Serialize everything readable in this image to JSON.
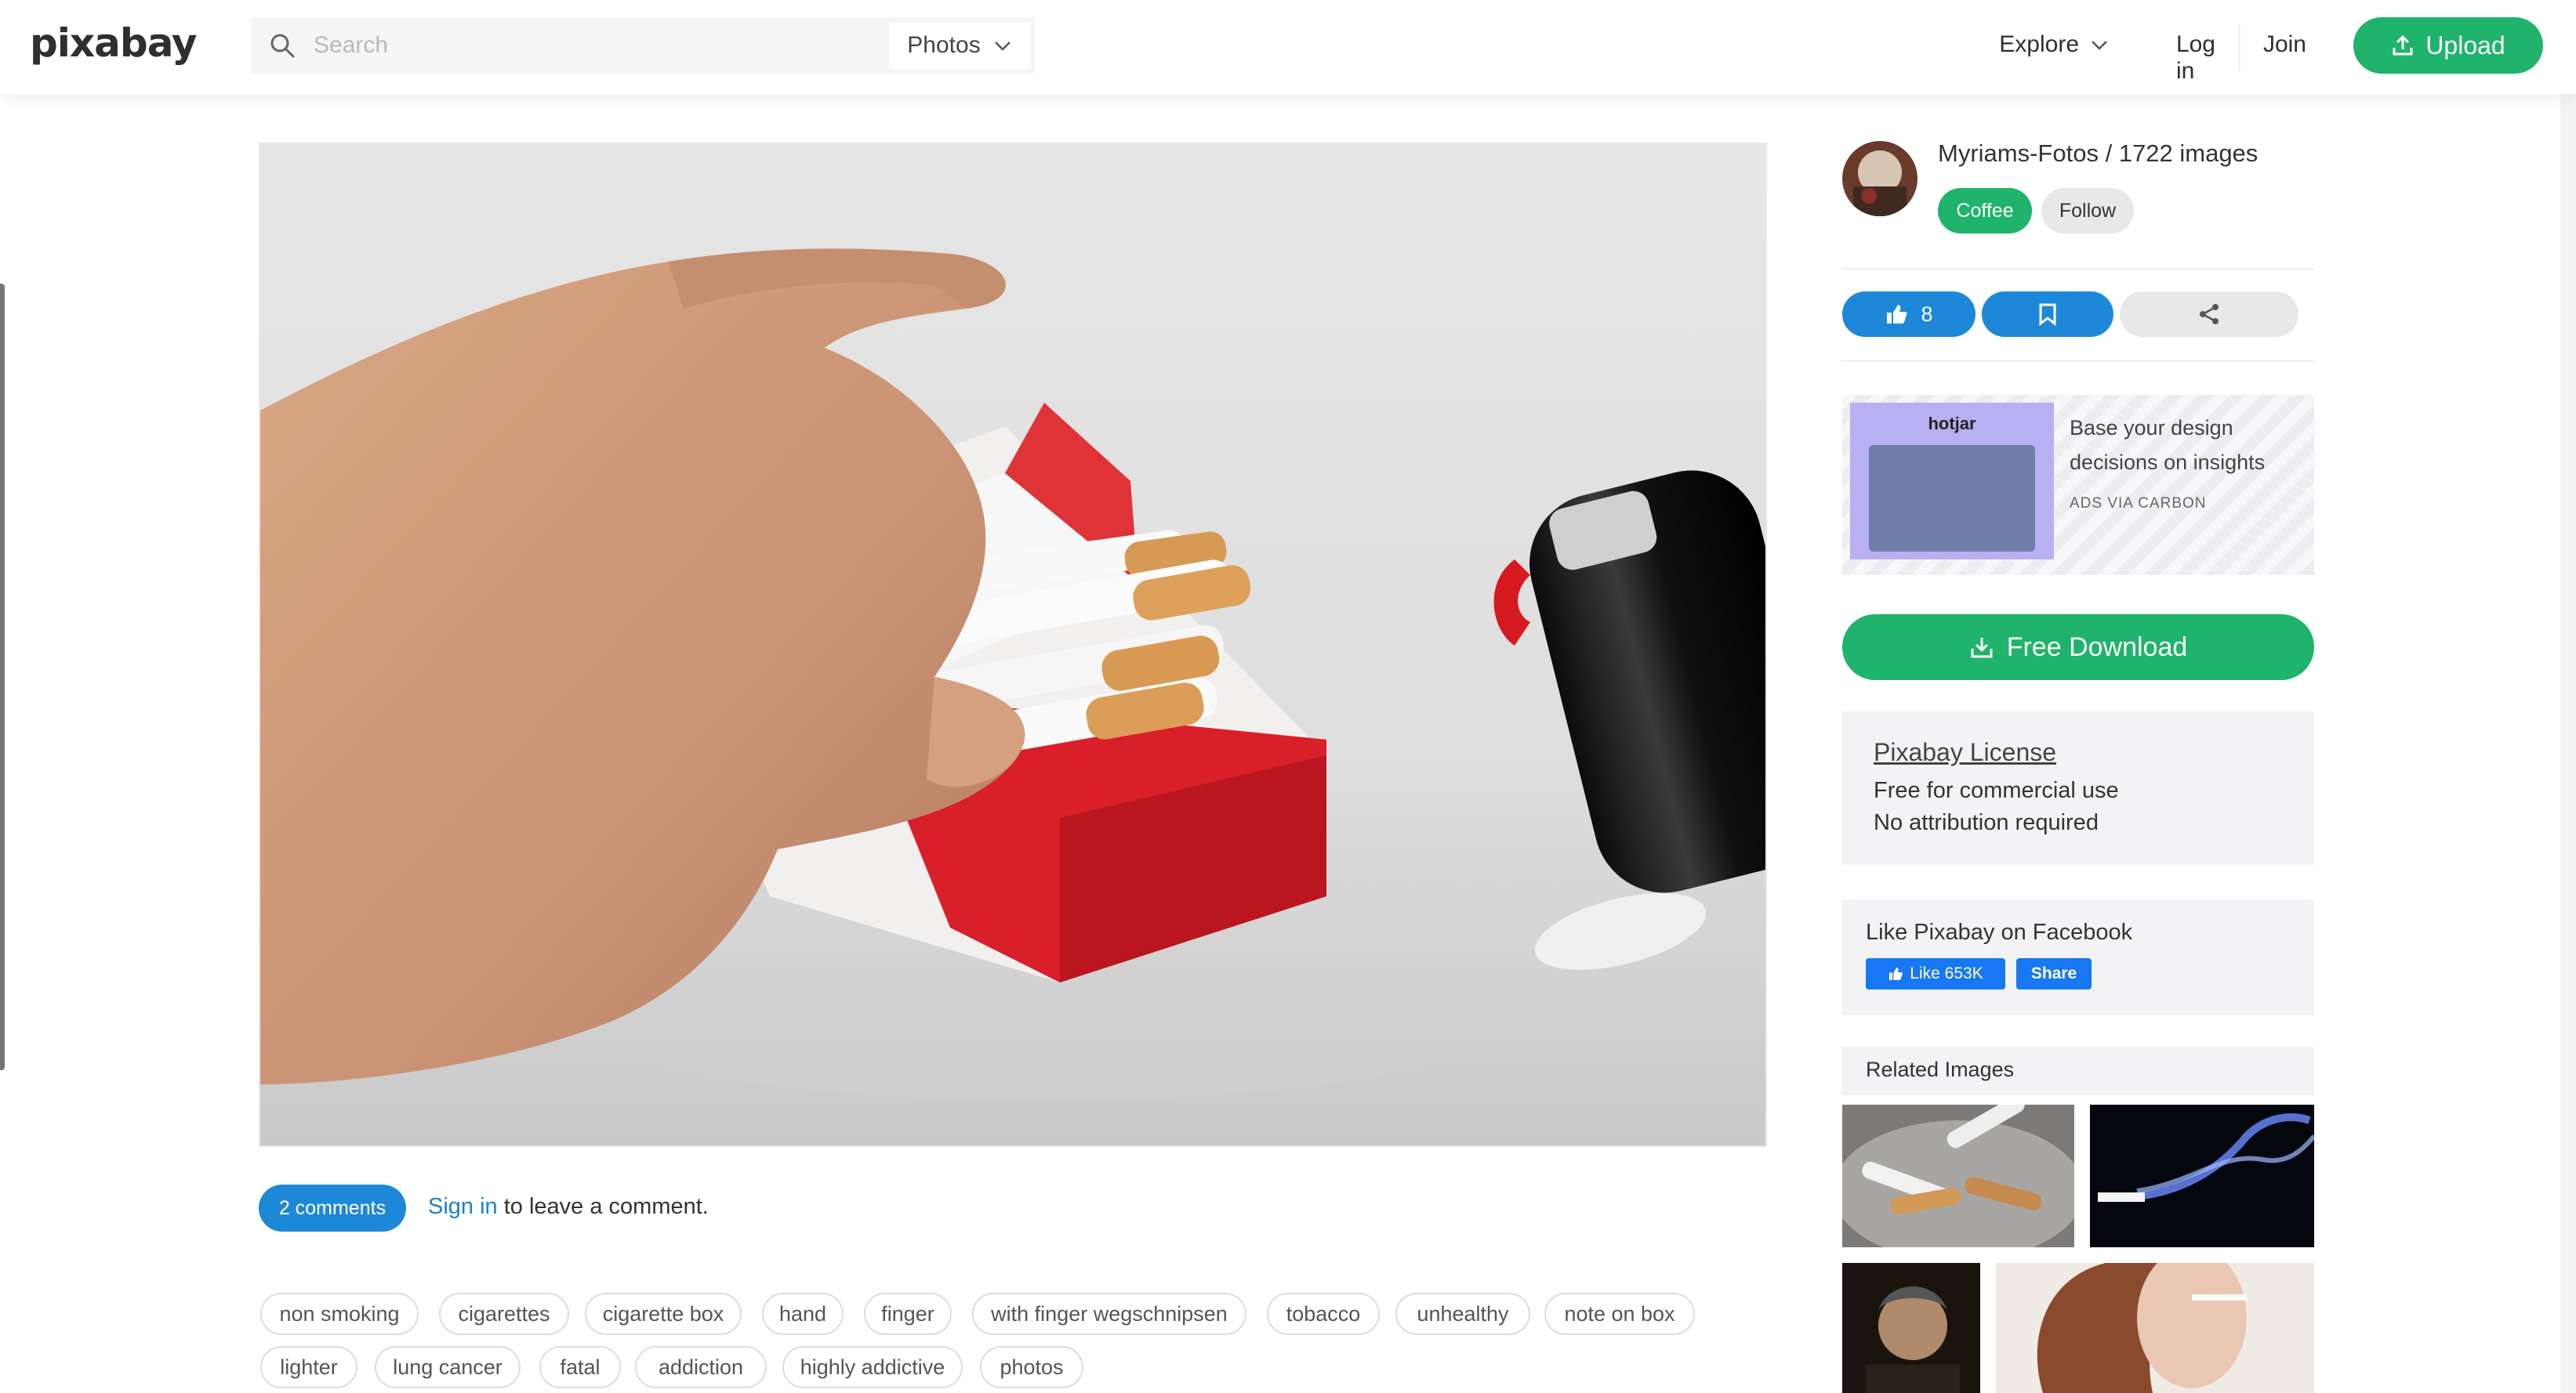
{
  "header": {
    "logo": "pixabay",
    "search_placeholder": "Search",
    "search_type": "Photos",
    "nav": {
      "explore": "Explore",
      "login": "Log in",
      "join": "Join",
      "upload": "Upload"
    }
  },
  "sidebar": {
    "author": "Myriams-Fotos / 1722 images",
    "coffee_label": "Coffee",
    "follow_label": "Follow",
    "like_count": "8",
    "ad": {
      "brand": "hotjar",
      "text": "Base your design decisions on insights",
      "via": "ADS VIA CARBON"
    },
    "download_label": "Free Download",
    "license": {
      "title": "Pixabay License",
      "line1": "Free for commercial use",
      "line2": "No attribution required"
    },
    "facebook": {
      "title": "Like Pixabay on Facebook",
      "like_label": "Like 653K",
      "share_label": "Share"
    },
    "related_title": "Related Images"
  },
  "comments": {
    "badge": "2 comments",
    "signin_link": "Sign in",
    "signin_rest": " to leave a comment."
  },
  "tags": [
    "non smoking",
    "cigarettes",
    "cigarette box",
    "hand",
    "finger",
    "with finger wegschnipsen",
    "tobacco",
    "unhealthy",
    "note on box",
    "lighter",
    "lung cancer",
    "fatal",
    "addiction",
    "highly addictive",
    "photos"
  ],
  "colors": {
    "brand_green": "#1fb36b",
    "action_blue": "#1d88d8",
    "facebook_blue": "#1877f2"
  }
}
